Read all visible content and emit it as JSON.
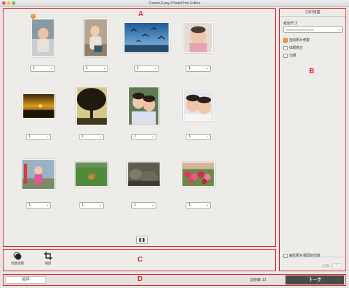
{
  "window": {
    "title": "Canon Easy-PhotoPrint Editor"
  },
  "callouts": {
    "a": "A",
    "b": "B",
    "c": "C",
    "d": "D"
  },
  "photos": [
    {
      "qty": "1",
      "desc": "baby-1"
    },
    {
      "qty": "1",
      "desc": "baby-2"
    },
    {
      "qty": "1",
      "desc": "birds"
    },
    {
      "qty": "1",
      "desc": "baby-3"
    },
    {
      "qty": "1",
      "desc": "sunset"
    },
    {
      "qty": "1",
      "desc": "tree"
    },
    {
      "qty": "1",
      "desc": "kids-1"
    },
    {
      "qty": "1",
      "desc": "kids-2"
    },
    {
      "qty": "1",
      "desc": "girl-playground"
    },
    {
      "qty": "1",
      "desc": "dog-grass"
    },
    {
      "qty": "1",
      "desc": "rocks"
    },
    {
      "qty": "1",
      "desc": "flowers"
    }
  ],
  "print_settings": {
    "header": "打印设置",
    "paper_size_label": "纸张尺寸",
    "paper_size_value": "",
    "options": [
      {
        "label": "自动照片修复",
        "checked": true
      },
      {
        "label": "红眼修正",
        "checked": false
      },
      {
        "label": "日期",
        "checked": false
      }
    ],
    "same_copies_label": "每张照片相同的份数",
    "copies_label": "份数:",
    "copies_value": "1"
  },
  "tools": {
    "filter_label": "创意滤镜",
    "crop_label": "裁剪"
  },
  "bottom": {
    "back_label": "返回",
    "total_label": "总份数: 12",
    "next_label": "下一步"
  },
  "colors": {
    "accent": "#d9222a",
    "check": "#f08a24",
    "next_btn": "#4a4a4a"
  }
}
